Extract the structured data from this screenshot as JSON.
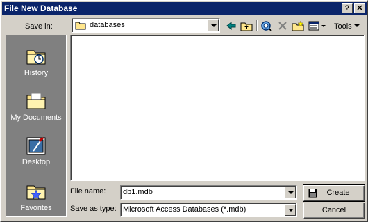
{
  "window": {
    "title": "File New Database",
    "help_button": "?",
    "close_button": "✕"
  },
  "toolbar": {
    "save_in_label": "Save in:",
    "save_in_value": "databases",
    "tools_label": "Tools"
  },
  "places": [
    {
      "label": "History",
      "icon": "history-folder-icon"
    },
    {
      "label": "My Documents",
      "icon": "my-documents-folder-icon"
    },
    {
      "label": "Desktop",
      "icon": "desktop-icon"
    },
    {
      "label": "Favorites",
      "icon": "favorites-folder-icon"
    }
  ],
  "bottom": {
    "file_name_label": "File name:",
    "file_name_value": "db1.mdb",
    "save_as_type_label": "Save as type:",
    "save_as_type_value": "Microsoft Access Databases (*.mdb)",
    "create_label": "Create",
    "cancel_label": "Cancel"
  }
}
